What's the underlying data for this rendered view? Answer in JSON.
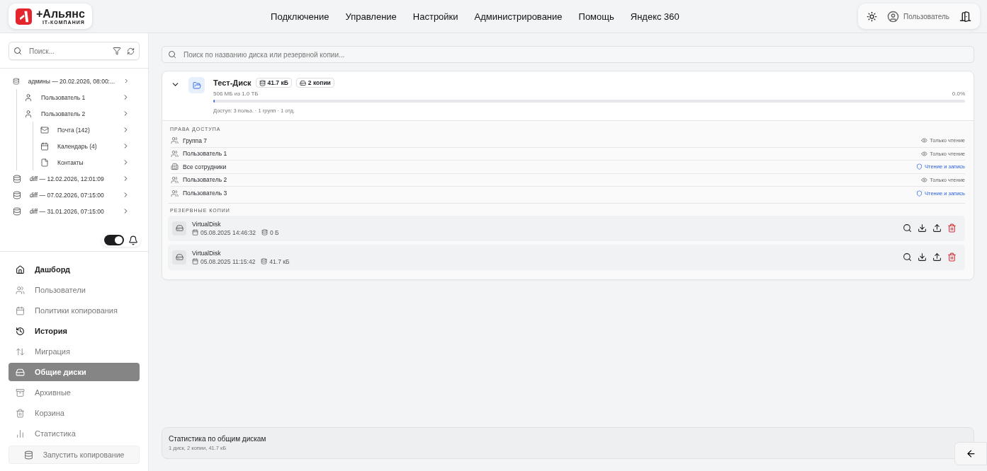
{
  "brand": {
    "name": "+Альянс",
    "tagline": "IT-КОМПАНИЯ"
  },
  "top_nav": [
    "Подключение",
    "Управление",
    "Настройки",
    "Администрирование",
    "Помощь",
    "Яндекс 360"
  ],
  "user_menu": {
    "name": "Пользователь"
  },
  "sidebar": {
    "search": {
      "placeholder": "Поиск..."
    },
    "tree": [
      {
        "kind": "backup",
        "label": "админы — 20.02.2026, 08:00:...",
        "children": [
          {
            "kind": "user",
            "label": "Пользователь 1"
          },
          {
            "kind": "user",
            "label": "Пользователь 2",
            "children": [
              {
                "kind": "mail",
                "label": "Почта (142)"
              },
              {
                "kind": "calendar",
                "label": "Календарь (4)"
              },
              {
                "kind": "contacts",
                "label": "Контакты"
              }
            ]
          }
        ]
      },
      {
        "kind": "backup",
        "label": "diff — 12.02.2026, 12:01:09"
      },
      {
        "kind": "backup",
        "label": "diff — 07.02.2026, 07:15:00"
      },
      {
        "kind": "backup",
        "label": "diff — 31.01.2026, 07:15:00"
      }
    ],
    "toggle": {
      "on": true
    },
    "nav": [
      {
        "kind": "home",
        "label": "Дашборд",
        "selected": false,
        "emphasized": true
      },
      {
        "kind": "users",
        "label": "Пользователи",
        "selected": false,
        "emphasized": false
      },
      {
        "kind": "calendar",
        "label": "Политики копирования",
        "selected": false,
        "emphasized": false
      },
      {
        "kind": "history",
        "label": "История",
        "selected": false,
        "emphasized": true
      },
      {
        "kind": "migrate",
        "label": "Миграция",
        "selected": false,
        "emphasized": false
      },
      {
        "kind": "drive",
        "label": "Общие диски",
        "selected": true,
        "emphasized": true
      },
      {
        "kind": "archive",
        "label": "Архивные",
        "selected": false,
        "emphasized": false
      },
      {
        "kind": "trash",
        "label": "Корзина",
        "selected": false,
        "emphasized": false
      },
      {
        "kind": "stats",
        "label": "Статистика",
        "selected": false,
        "emphasized": false
      }
    ],
    "run_button": "Запустить копирование"
  },
  "main": {
    "search": {
      "placeholder": "Поиск по названию диска или резервной копии..."
    },
    "disk": {
      "name": "Тест-Диск",
      "size_badge": "41.7 кБ",
      "copies_badge": "2 копии",
      "expanded": true,
      "usage": "506 МБ из 1.0 ТБ",
      "percent": "0.0%",
      "level": 0.002,
      "access_summary": "Доступ: 3 польз. · 1 групп · 1 отд.",
      "access_title": "ПРАВА ДОСТУПА",
      "access": [
        {
          "kind": "people",
          "name": "Группа 7",
          "permission": {
            "kind": "read",
            "label": "Только чтение"
          }
        },
        {
          "kind": "people",
          "name": "Пользователь 1",
          "permission": {
            "kind": "read",
            "label": "Только чтение"
          }
        },
        {
          "kind": "building",
          "name": "Все сотрудники",
          "permission": {
            "kind": "readwrite",
            "label": "Чтение и запись"
          }
        },
        {
          "kind": "people",
          "name": "Пользователь 2",
          "permission": {
            "kind": "read",
            "label": "Только чтение"
          }
        },
        {
          "kind": "people",
          "name": "Пользователь 3",
          "permission": {
            "kind": "readwrite",
            "label": "Чтение и запись"
          }
        }
      ],
      "backups_title": "РЕЗЕРВНЫЕ КОПИИ",
      "backups": [
        {
          "name": "VirtualDisk",
          "date": "05.08.2025 14:46:32",
          "size": "0 Б"
        },
        {
          "name": "VirtualDisk",
          "date": "05.08.2025 11:15:42",
          "size": "41.7 кБ"
        }
      ]
    },
    "stats": {
      "title": "Статистика по общим дискам",
      "summary": "1 диск, 2 копии, 41.7 кБ"
    }
  }
}
